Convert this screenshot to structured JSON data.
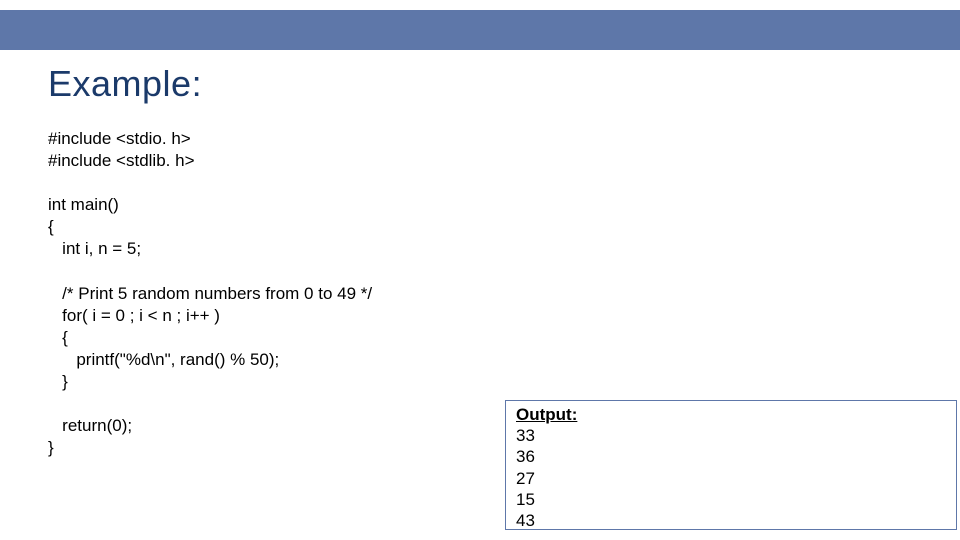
{
  "slide": {
    "title": "Example:"
  },
  "code": {
    "l1": "#include <stdio. h>",
    "l2": "#include <stdlib. h>",
    "l3": "",
    "l4": "int main()",
    "l5": "{",
    "l6": "   int i, n = 5;",
    "l7": "",
    "l8": "   /* Print 5 random numbers from 0 to 49 */",
    "l9": "   for( i = 0 ; i < n ; i++ )",
    "l10": "   {",
    "l11": "      printf(\"%d\\n\", rand() % 50);",
    "l12": "   }",
    "l13": "",
    "l14": "   return(0);",
    "l15": "}"
  },
  "output": {
    "label": "Output:",
    "values": [
      "33",
      "36",
      "27",
      "15",
      "43"
    ]
  }
}
